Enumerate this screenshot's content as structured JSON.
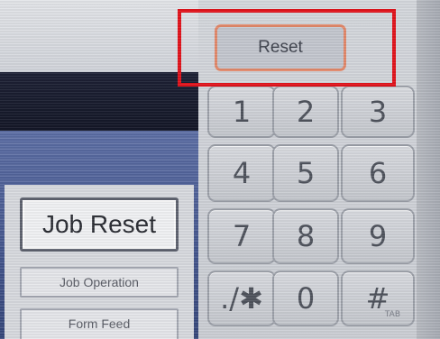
{
  "panel": {
    "reset_label": "Reset",
    "job_reset_label": "Job Reset",
    "job_operation_label": "Job Operation",
    "form_feed_label": "Form Feed"
  },
  "keypad": {
    "keys": [
      "1",
      "2",
      "3",
      "4",
      "5",
      "6",
      "7",
      "8",
      "9",
      "./✱",
      "0",
      "#"
    ],
    "hash_sub_label": "TAB"
  },
  "colors": {
    "highlight": "#e3141c",
    "reset_border": "#e48a6c",
    "left_panel_blue": "#42548c"
  }
}
